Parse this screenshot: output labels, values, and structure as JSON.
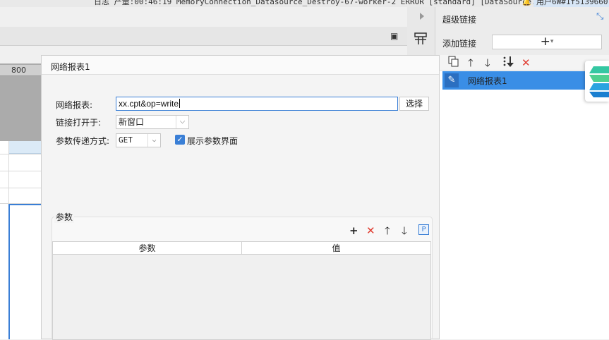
{
  "status_bar": {
    "log": "日志  产量:00:46:19 MemoryConnection_Datasource_Destroy-67-worker-2 ERROR [standard] [DataSource...",
    "user": "用户6W#1f5139660"
  },
  "ruler": {
    "mark": "800"
  },
  "right_panel": {
    "title": "超级链接",
    "add_label": "添加链接",
    "add_button": "+",
    "link_items": [
      {
        "label": "网络报表1"
      }
    ]
  },
  "dialog": {
    "title": "网络报表1",
    "report_label": "网络报表:",
    "report_value": "xx.cpt&op=write",
    "choose_button": "选择",
    "open_label": "链接打开于:",
    "open_value": "新窗口",
    "method_label": "参数传递方式:",
    "method_value": "GET",
    "show_params_label": "展示参数界面",
    "show_params_checked": true,
    "params_section": "参数",
    "params_columns": [
      "参数",
      "值"
    ]
  },
  "colors": {
    "accent": "#3a7fd6",
    "selected_item": "#3a8ee6",
    "delete": "#e03c31"
  }
}
